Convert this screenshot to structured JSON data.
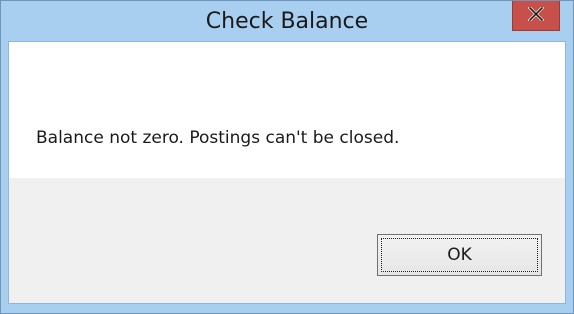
{
  "window": {
    "title": "Check Balance",
    "close_icon": "close-icon"
  },
  "dialog": {
    "message": "Balance not zero. Postings can't be closed.",
    "ok_label": "OK"
  },
  "colors": {
    "frame": "#a9cff0",
    "close_button": "#c7504a",
    "footer": "#f0f0f0"
  }
}
